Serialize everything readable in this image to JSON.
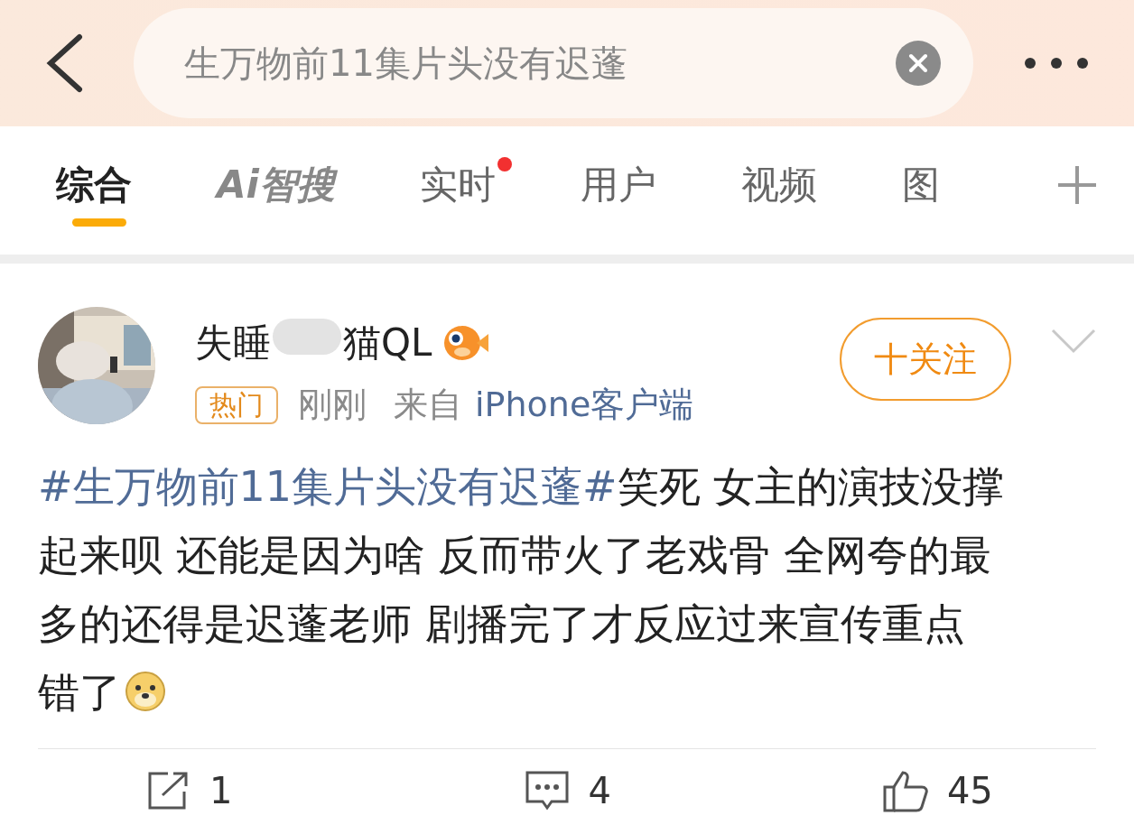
{
  "search": {
    "value": "生万物前11集片头没有迟蓬"
  },
  "tabs": [
    {
      "label": "综合",
      "selected": true,
      "kind": "text"
    },
    {
      "label": "Ai智搜",
      "selected": false,
      "kind": "ai"
    },
    {
      "label": "实时",
      "selected": false,
      "dot": true,
      "kind": "text"
    },
    {
      "label": "用户",
      "selected": false,
      "kind": "text"
    },
    {
      "label": "视频",
      "selected": false,
      "kind": "text"
    },
    {
      "label": "图",
      "selected": false,
      "kind": "text"
    }
  ],
  "post": {
    "name_parts": [
      "失睡",
      "猫QL"
    ],
    "follow": "十关注",
    "badge": "热门",
    "time": "刚刚",
    "source_prefix": "来自",
    "source": "iPhone客户端",
    "hashtag": "#生万物前11集片头没有迟蓬#",
    "text_lines": [
      "笑死 女主的演技没撑",
      "起来呗 还能是因为啥 反而带火了老戏骨 全网夸的最",
      "多的还得是迟蓬老师 剧播完了才反应过来宣传重点",
      "错了"
    ],
    "actions": [
      {
        "kind": "repost",
        "count": "1"
      },
      {
        "kind": "comment",
        "count": "4"
      },
      {
        "kind": "like",
        "count": "45"
      }
    ]
  }
}
